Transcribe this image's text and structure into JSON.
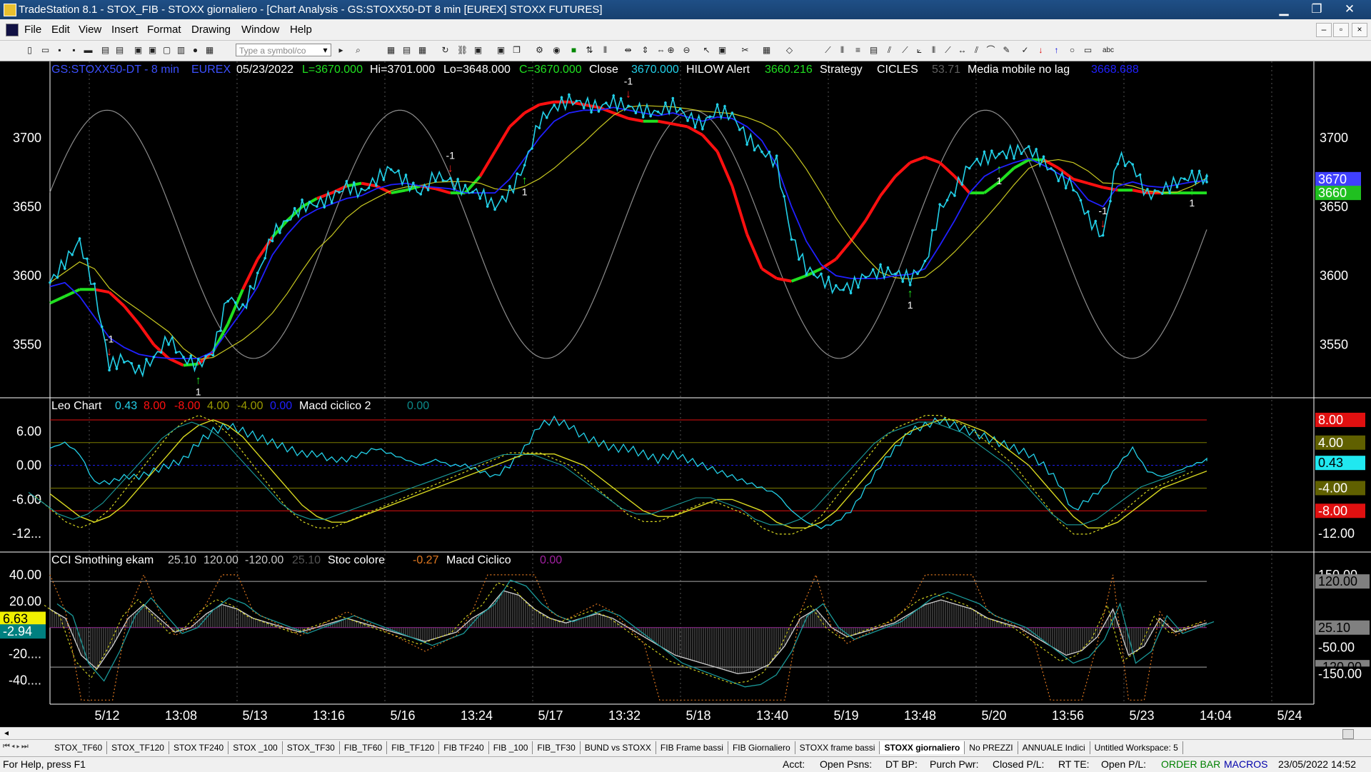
{
  "window": {
    "title": "TradeStation 8.1 - STOX_FIB - STOXX giornaliero - [Chart Analysis - GS:STOXX50-DT  8 min  [EUREX] STOXX FUTURES]",
    "minimize": "▁",
    "maximize": "❐",
    "close": "✕"
  },
  "menu": [
    "File",
    "Edit",
    "View",
    "Insert",
    "Format",
    "Drawing",
    "Window",
    "Help"
  ],
  "toolbar": {
    "symbol_placeholder": "Type a symbol/co"
  },
  "colors": {
    "price": "#22d0e8",
    "ma_fast": "#2020ff",
    "ma_slow": "#c8c820",
    "hilow_up": "#20e020",
    "hilow_down": "#ff1010",
    "sine": "#8c8c8c",
    "axis_text": "#ffffff"
  },
  "chart_data": [
    {
      "type": "line",
      "panel": "price",
      "header": {
        "symbol": "GS:STOXX50-DT - 8 min",
        "exchange": "EUREX",
        "date": "05/23/2022",
        "last": "L=3670.000",
        "high": "Hi=3701.000",
        "low": "Lo=3648.000",
        "close": "C=3670.000",
        "close_label": "Close",
        "close_value": "3670.000",
        "ind1_name": "HILOW Alert",
        "ind1_value": "3660.216",
        "ind2_name": "Strategy",
        "ind3_name": "CICLES",
        "ind3_value": "53.71",
        "ind4_name": "Media mobile no lag",
        "ind4_value": "3668.688"
      },
      "y_ticks": [
        "3700",
        "3650",
        "3600",
        "3550"
      ],
      "y_tick_values": [
        3700,
        3650,
        3600,
        3550
      ],
      "ylim": [
        3513,
        3745
      ],
      "price_markers": [
        {
          "label": "3670",
          "value": 3670,
          "color": "#4040ff"
        },
        {
          "label": "3660",
          "value": 3660,
          "color": "#20c020"
        }
      ],
      "series": [
        {
          "name": "Close",
          "values": [
            3595,
            3610,
            3625,
            3590,
            3535,
            3540,
            3530,
            3540,
            3555,
            3540,
            3535,
            3545,
            3585,
            3575,
            3600,
            3630,
            3640,
            3650,
            3652,
            3657,
            3665,
            3660,
            3670,
            3678,
            3668,
            3660,
            3673,
            3668,
            3662,
            3660,
            3650,
            3660,
            3680,
            3712,
            3722,
            3727,
            3725,
            3722,
            3726,
            3722,
            3720,
            3718,
            3724,
            3715,
            3710,
            3720,
            3716,
            3700,
            3690,
            3682,
            3628,
            3605,
            3598,
            3590,
            3592,
            3600,
            3603,
            3602,
            3598,
            3608,
            3648,
            3662,
            3680,
            3685,
            3688,
            3690,
            3692,
            3682,
            3672,
            3665,
            3642,
            3628,
            3686,
            3680,
            3658,
            3662,
            3668,
            3672,
            3670
          ]
        },
        {
          "name": "Media mobile no lag",
          "values": [
            3592,
            3595,
            3585,
            3570,
            3555,
            3548,
            3543,
            3541,
            3540,
            3540,
            3540,
            3545,
            3560,
            3575,
            3592,
            3615,
            3630,
            3642,
            3648,
            3652,
            3656,
            3658,
            3663,
            3666,
            3667,
            3665,
            3664,
            3663,
            3660,
            3660,
            3660,
            3670,
            3685,
            3700,
            3712,
            3718,
            3720,
            3720,
            3722,
            3720,
            3718,
            3716,
            3718,
            3715,
            3712,
            3715,
            3714,
            3708,
            3698,
            3680,
            3650,
            3625,
            3608,
            3600,
            3598,
            3598,
            3598,
            3600,
            3601,
            3605,
            3622,
            3640,
            3660,
            3672,
            3678,
            3682,
            3685,
            3680,
            3674,
            3668,
            3655,
            3650,
            3665,
            3668,
            3665,
            3664,
            3666,
            3668,
            3669
          ]
        },
        {
          "name": "HILOW Alert",
          "values": [
            3580,
            3585,
            3590,
            3590,
            3588,
            3578,
            3565,
            3550,
            3540,
            3535,
            3536,
            3545,
            3565,
            3590,
            3612,
            3628,
            3640,
            3650,
            3656,
            3660,
            3665,
            3667,
            3665,
            3660,
            3662,
            3665,
            3663,
            3660,
            3660,
            3672,
            3690,
            3708,
            3718,
            3724,
            3726,
            3726,
            3724,
            3722,
            3718,
            3714,
            3712,
            3712,
            3710,
            3708,
            3702,
            3690,
            3665,
            3630,
            3605,
            3598,
            3596,
            3600,
            3605,
            3612,
            3625,
            3640,
            3658,
            3672,
            3682,
            3686,
            3682,
            3672,
            3660,
            3660,
            3668,
            3678,
            3684,
            3684,
            3678,
            3670,
            3667,
            3664,
            3662,
            3662,
            3660,
            3660,
            3660,
            3660,
            3660
          ]
        }
      ]
    },
    {
      "type": "line",
      "panel": "oscillator",
      "header": {
        "name": "Leo Chart",
        "v1": "0.43",
        "v2": "8.00",
        "v3": "-8.00",
        "v4": "4.00",
        "v5": "-4.00",
        "v6": "0.00",
        "name2": "Macd ciclico 2",
        "v7": "0.00"
      },
      "y_ticks": [
        "6.00",
        "0.00",
        "-6.00",
        "-12..."
      ],
      "y_tick_values": [
        6,
        0,
        -6,
        -12
      ],
      "ylim": [
        -15,
        9.5
      ],
      "reference_lines": [
        8,
        4,
        0,
        -4,
        -8
      ],
      "right_markers": [
        {
          "label": "8.00",
          "value": 8,
          "color": "#e01010",
          "text": "#ffffff"
        },
        {
          "label": "4.00",
          "value": 4,
          "color": "#606000",
          "text": "#ffffff"
        },
        {
          "label": "0.43",
          "value": 0.43,
          "color": "#20e8f0",
          "text": "#000000"
        },
        {
          "label": "-4.00",
          "value": -4,
          "color": "#606000",
          "text": "#ffffff"
        },
        {
          "label": "-8.00",
          "value": -8,
          "color": "#e01010",
          "text": "#ffffff"
        },
        {
          "label": "-12.00",
          "value": -12,
          "color": "#000000",
          "text": "#ffffff"
        }
      ],
      "series": [
        {
          "name": "Leo Chart",
          "values": [
            3,
            4,
            2,
            -3,
            -3,
            -2,
            -2,
            -1,
            0,
            1,
            4,
            6,
            7,
            6,
            5,
            4,
            3,
            2,
            2,
            1,
            1,
            2,
            3,
            2,
            1,
            0,
            1,
            0,
            0,
            -1,
            -2,
            0,
            3,
            7,
            8,
            7,
            5,
            4,
            3,
            3,
            2,
            1,
            2,
            1,
            0,
            -1,
            -2,
            -3,
            -4,
            -5,
            -8,
            -10,
            -11,
            -10,
            -8,
            -4,
            0,
            3,
            6,
            7,
            8,
            7,
            6,
            5,
            4,
            3,
            2,
            0,
            -3,
            -8,
            -6,
            -4,
            0,
            3,
            -1,
            -2,
            -1,
            0,
            1
          ]
        },
        {
          "name": "Macd ciclico 2",
          "values": [
            -5,
            -7,
            -9,
            -10,
            -9,
            -7,
            -4,
            -1,
            2,
            5,
            7,
            8,
            7,
            5,
            2,
            -1,
            -4,
            -7,
            -9,
            -10,
            -10,
            -9,
            -8,
            -7,
            -6,
            -5,
            -4,
            -3,
            -2,
            -1,
            0,
            1,
            2,
            2,
            2,
            1,
            0,
            -2,
            -4,
            -6,
            -8,
            -9,
            -9,
            -8,
            -7,
            -6,
            -6,
            -7,
            -8,
            -10,
            -11,
            -11,
            -10,
            -8,
            -5,
            -2,
            1,
            4,
            6,
            7,
            8,
            8,
            7,
            6,
            4,
            2,
            0,
            -3,
            -6,
            -9,
            -11,
            -11,
            -10,
            -8,
            -6,
            -4,
            -3,
            -2,
            -1
          ]
        }
      ]
    },
    {
      "type": "line",
      "panel": "cci",
      "header": {
        "name": "CCI Smothing ekam",
        "v1": "25.10",
        "v2": "120.00",
        "v3": "-120.00",
        "v4": "25.10",
        "name2": "Stoc colore",
        "v5": "-0.27",
        "name3": "Macd Ciclico",
        "v6": "0.00"
      },
      "y_ticks": [
        "40.00",
        "20.00",
        "0.00",
        "-20....",
        "-40...."
      ],
      "y_tick_values": [
        40,
        20,
        0,
        -20,
        -40
      ],
      "ylim": [
        -57,
        47
      ],
      "left_markers": [
        {
          "label": "6.63",
          "value": 6.63,
          "color": "#f0f000",
          "text": "#000000"
        },
        {
          "label": "-2.94",
          "value": -2.94,
          "color": "#008080",
          "text": "#ffffff"
        }
      ],
      "right_markers": [
        {
          "label": "150.00",
          "value": 40,
          "color": "#000000",
          "text": "#ffffff"
        },
        {
          "label": "120.00",
          "value": 35,
          "color": "#808080",
          "text": "#000000"
        },
        {
          "label": "25.10",
          "value": 0,
          "color": "#808080",
          "text": "#000000"
        },
        {
          "label": "-50.00",
          "value": -15,
          "color": "#000000",
          "text": "#ffffff"
        },
        {
          "label": "-120.00",
          "value": -30,
          "color": "#808080",
          "text": "#000000"
        },
        {
          "label": "-150.00",
          "value": -35,
          "color": "#000000",
          "text": "#ffffff"
        }
      ],
      "series": [
        {
          "name": "CCI Smothing ekam",
          "values": [
            20,
            10,
            -30,
            -45,
            -20,
            10,
            25,
            10,
            -5,
            0,
            15,
            25,
            20,
            10,
            5,
            0,
            -5,
            0,
            5,
            10,
            5,
            0,
            -5,
            -10,
            -15,
            -10,
            -5,
            10,
            20,
            40,
            35,
            20,
            10,
            5,
            10,
            15,
            10,
            0,
            -10,
            -20,
            -30,
            -35,
            -40,
            -45,
            -50,
            -48,
            -40,
            -20,
            10,
            20,
            0,
            -10,
            -5,
            0,
            5,
            15,
            25,
            30,
            25,
            20,
            10,
            5,
            0,
            -10,
            -20,
            -30,
            -25,
            -10,
            20,
            -30,
            -20,
            10,
            -5,
            0,
            5
          ]
        }
      ]
    }
  ],
  "x_labels": [
    "5/12",
    "13:08",
    "5/13",
    "13:16",
    "5/16",
    "13:24",
    "5/17",
    "13:32",
    "5/18",
    "13:40",
    "5/19",
    "13:48",
    "5/20",
    "13:56",
    "5/23",
    "14:04",
    "5/24"
  ],
  "signals": {
    "up": [
      "1",
      "1",
      "1",
      "1",
      "1"
    ],
    "down": [
      "-1",
      "-1",
      "-1",
      "-1"
    ]
  },
  "tabs": [
    "STOX_TF60",
    "STOX_TF120",
    "STOX TF240",
    "STOX _100",
    "STOX_TF30",
    "FIB_TF60",
    "FIB_TF120",
    "FIB TF240",
    "FIB _100",
    "FIB_TF30",
    "BUND vs STOXX",
    "FIB Frame bassi",
    "FIB Giornaliero",
    "STOXX frame bassi",
    "STOXX giornaliero",
    "No PREZZI",
    "ANNUALE Indici",
    "Untitled Workspace:  5"
  ],
  "active_tab": "STOXX giornaliero",
  "status": {
    "help": "For Help, press F1",
    "acct": "Acct:",
    "open_psns": "Open Psns:",
    "dt_bp": "DT BP:",
    "purch_pwr": "Purch Pwr:",
    "closed_pl": "Closed P/L:",
    "rt_te": "RT TE:",
    "open_pl": "Open P/L:",
    "order_bar": "ORDER BAR",
    "macros": "MACROS",
    "datetime": "23/05/2022 14:52"
  }
}
